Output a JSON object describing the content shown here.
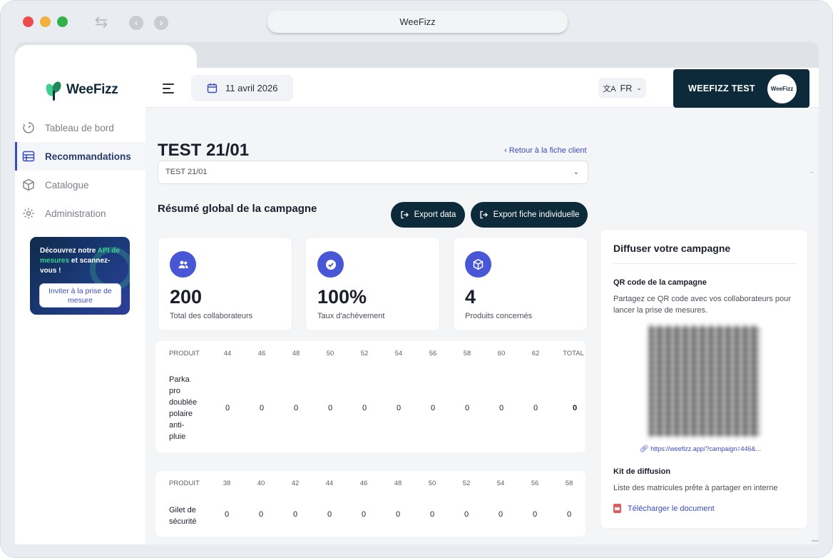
{
  "window": {
    "title": "WeeFizz"
  },
  "brand": {
    "logo_text": "WeeFizz",
    "accent": "#3b4cc0",
    "dark": "#0d2a3a",
    "green": "#3ecf8e"
  },
  "sidebar": {
    "items": [
      {
        "label": "Tableau de bord",
        "icon": "dashboard-icon",
        "active": false
      },
      {
        "label": "Recommandations",
        "icon": "table-icon",
        "active": true
      },
      {
        "label": "Catalogue",
        "icon": "box-icon",
        "active": false
      },
      {
        "label": "Administration",
        "icon": "gear-icon",
        "active": false
      }
    ],
    "promo": {
      "text_before": "Découvrez notre ",
      "highlight": "API de mesures",
      "text_after": " et scannez-vous !",
      "button": "Inviter à la prise de mesure"
    }
  },
  "header": {
    "date": "11 avril 2026",
    "language": "FR",
    "account_name": "WEEFIZZ TEST",
    "avatar_text": "WeeFizz"
  },
  "main": {
    "title": "TEST 21/01",
    "back_link": "Retour à la fiche client",
    "campaign_select": "TEST 21/01",
    "summary_title": "Résumé global de la campagne",
    "export_data": "Export data",
    "export_individual": "Export fiche individuelle",
    "stats": [
      {
        "value": "200",
        "label": "Total des collaborateurs",
        "icon": "users-icon"
      },
      {
        "value": "100%",
        "label": "Taux d'achèvement",
        "icon": "check-circle-icon"
      },
      {
        "value": "4",
        "label": "Produits concernés",
        "icon": "package-icon"
      }
    ],
    "tables": [
      {
        "header_product": "PRODUIT",
        "sizes": [
          "44",
          "46",
          "48",
          "50",
          "52",
          "54",
          "56",
          "58",
          "60",
          "62",
          "TOTAL"
        ],
        "rows": [
          {
            "product_lines": [
              "Parka",
              "pro",
              "doublée",
              "polaire",
              "anti-",
              "pluie"
            ],
            "values": [
              "0",
              "0",
              "0",
              "0",
              "0",
              "0",
              "0",
              "0",
              "0",
              "0",
              "0"
            ]
          }
        ]
      },
      {
        "header_product": "PRODUIT",
        "sizes": [
          "38",
          "40",
          "42",
          "44",
          "46",
          "48",
          "50",
          "52",
          "54",
          "56",
          "58"
        ],
        "rows": [
          {
            "product_lines": [
              "Gilet de",
              "sécurité"
            ],
            "values": [
              "0",
              "0",
              "0",
              "0",
              "0",
              "0",
              "0",
              "0",
              "0",
              "0",
              "0"
            ]
          }
        ]
      }
    ]
  },
  "panel": {
    "title": "Diffuser votre campagne",
    "qr_heading": "QR code de la campagne",
    "qr_desc": "Partagez ce QR code avec vos collaborateurs pour lancer la prise de mesures.",
    "qr_link": "https://weefizz.app/?campaign=446&...",
    "kit_heading": "Kit de diffusion",
    "kit_desc": "Liste des matricules prête à partager en interne",
    "download": "Télécharger le document"
  }
}
